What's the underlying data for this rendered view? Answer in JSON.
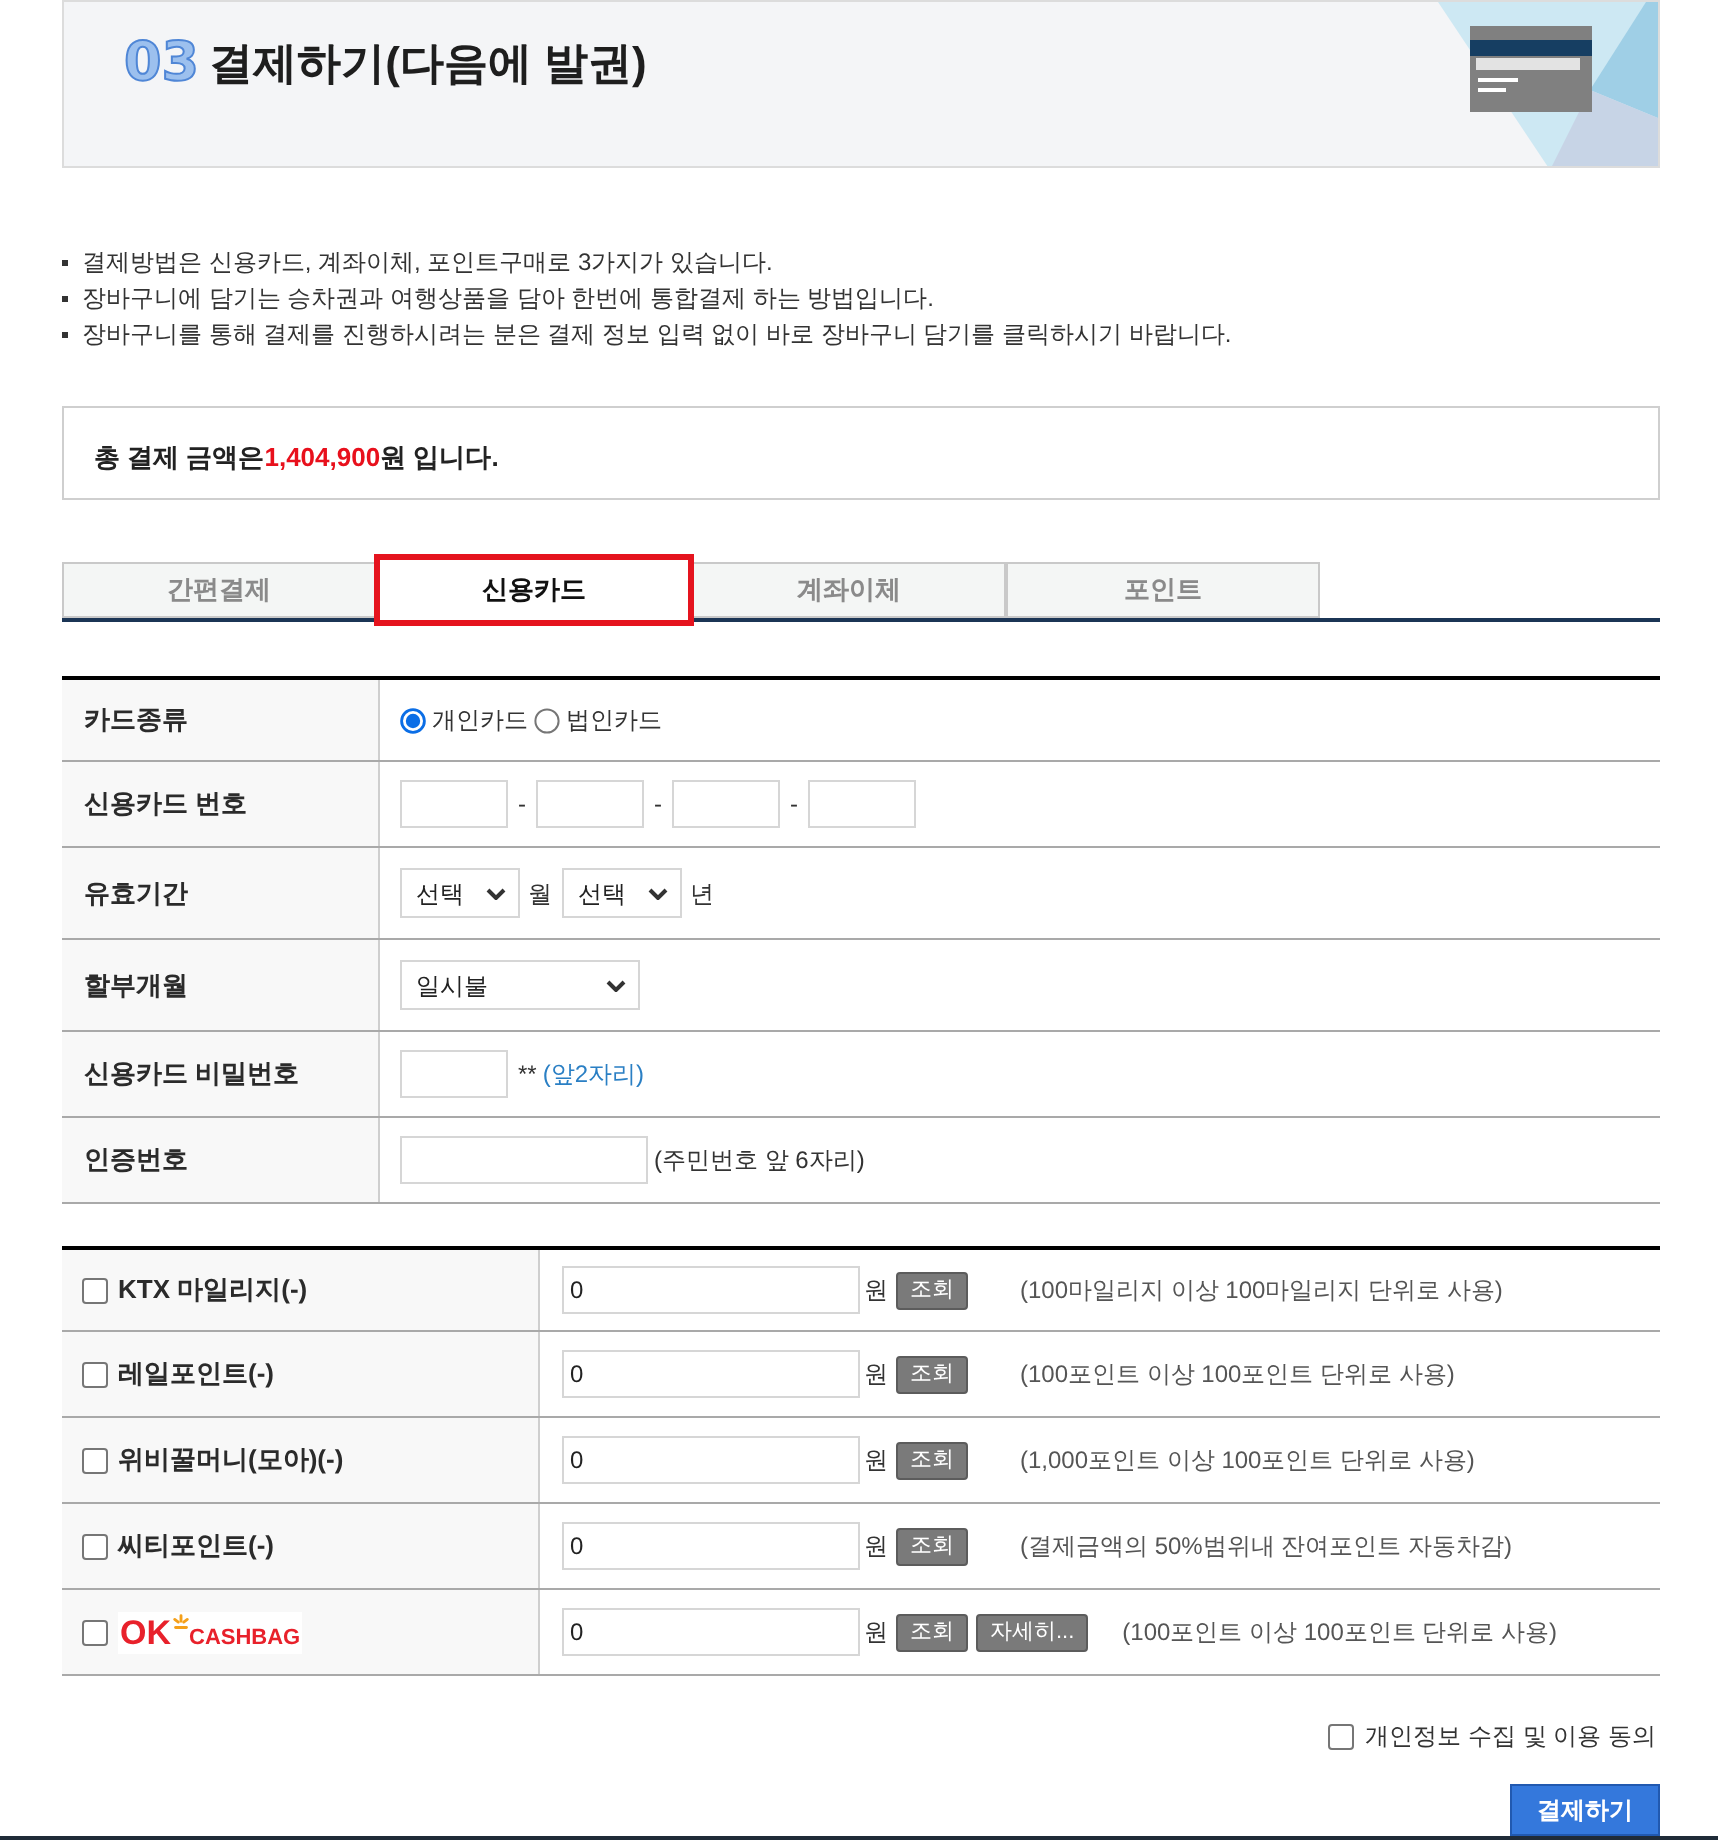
{
  "header": {
    "number": "03",
    "title": "결제하기(다음에 발권)"
  },
  "notes": [
    "결제방법은 신용카드, 계좌이체, 포인트구매로 3가지가 있습니다.",
    "장바구니에 담기는 승차권과 여행상품을 담아 한번에 통합결제 하는 방법입니다.",
    "장바구니를 통해 결제를 진행하시려는 분은 결제 정보 입력 없이 바로 장바구니 담기를 클릭하시기 바랍니다."
  ],
  "total": {
    "prefix": "총 결제 금액은",
    "amount": "1,404,900",
    "suffix": "원 입니다."
  },
  "tabs": [
    {
      "label": "간편결제",
      "selected": false
    },
    {
      "label": "신용카드",
      "selected": true
    },
    {
      "label": "계좌이체",
      "selected": false
    },
    {
      "label": "포인트",
      "selected": false
    }
  ],
  "card_form": {
    "rows": [
      {
        "kind": "radio",
        "label": "카드종류",
        "options": [
          {
            "label": "개인카드",
            "selected": true
          },
          {
            "label": "법인카드",
            "selected": false
          }
        ]
      },
      {
        "kind": "card_number",
        "label": "신용카드 번호",
        "separators": [
          "-",
          "-",
          "-"
        ]
      },
      {
        "kind": "expiry",
        "label": "유효기간",
        "selects": [
          {
            "value": "선택",
            "unit": "월"
          },
          {
            "value": "선택",
            "unit": "년"
          }
        ]
      },
      {
        "kind": "select",
        "label": "할부개월",
        "value": "일시불"
      },
      {
        "kind": "password",
        "label": "신용카드 비밀번호",
        "mask": "**",
        "hint": "(앞2자리)"
      },
      {
        "kind": "input_hint",
        "label": "인증번호",
        "hint": "(주민번호 앞 6자리)"
      }
    ]
  },
  "points": [
    {
      "kind": "text",
      "label": "KTX 마일리지(-)",
      "checked": false,
      "value": "0",
      "unit": "원",
      "buttons": [
        "조회"
      ],
      "note": "(100마일리지 이상 100마일리지 단위로 사용)"
    },
    {
      "kind": "text",
      "label": "레일포인트(-)",
      "checked": false,
      "value": "0",
      "unit": "원",
      "buttons": [
        "조회"
      ],
      "note": "(100포인트 이상 100포인트 단위로 사용)"
    },
    {
      "kind": "text",
      "label": "위비꿀머니(모아)(-)",
      "checked": false,
      "value": "0",
      "unit": "원",
      "buttons": [
        "조회"
      ],
      "note": "(1,000포인트 이상 100포인트 단위로 사용)"
    },
    {
      "kind": "text",
      "label": "씨티포인트(-)",
      "checked": false,
      "value": "0",
      "unit": "원",
      "buttons": [
        "조회"
      ],
      "note": "(결제금액의 50%범위내 잔여포인트 자동차감)"
    },
    {
      "kind": "logo",
      "logo": {
        "mark": "OK",
        "wordmark": "CASHBAG"
      },
      "checked": false,
      "value": "0",
      "unit": "원",
      "buttons": [
        "조회",
        "자세히..."
      ],
      "note": "(100포인트 이상 100포인트 단위로 사용)"
    }
  ],
  "consent": {
    "label": "개인정보 수집 및 이용 동의",
    "checked": false
  },
  "submit_button": "결제하기"
}
